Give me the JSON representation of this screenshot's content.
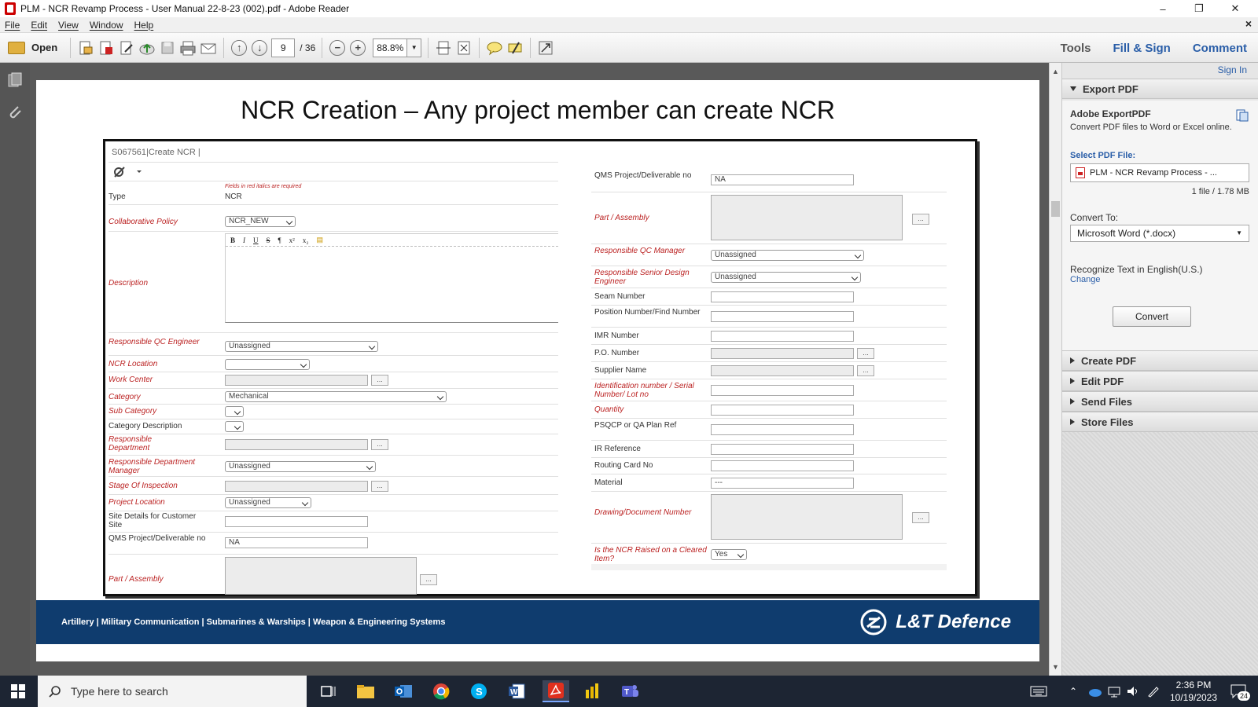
{
  "window": {
    "title": "PLM - NCR Revamp Process - User Manual 22-8-23 (002).pdf - Adobe Reader",
    "minimize": "–",
    "maximize": "❐",
    "close": "✕"
  },
  "menu": {
    "items": [
      "File",
      "Edit",
      "View",
      "Window",
      "Help"
    ],
    "close": "×"
  },
  "toolbar": {
    "open_label": "Open",
    "page_current": "9",
    "page_total": "/ 36",
    "zoom": "88.8%",
    "tools_label": "Tools",
    "fill_sign_label": "Fill & Sign",
    "comment_label": "Comment"
  },
  "slide": {
    "title": "NCR Creation – Any project member can create NCR",
    "footer_text": "Artillery | Military Communication | Submarines & Warships | Weapon & Engineering Systems",
    "logo_text": "L&T Defence"
  },
  "form": {
    "header": "S067561|Create NCR |",
    "required_note": "Fields in red italics are required",
    "left": {
      "type_label": "Type",
      "type_value": "NCR",
      "collab_label": "Collaborative Policy",
      "collab_value": "NCR_NEW",
      "description_label": "Description",
      "rte_buttons": [
        "B",
        "I",
        "U",
        "S",
        "¶",
        "x²",
        "x₂",
        "▤"
      ],
      "resp_qc_eng_label": "Responsible QC Engineer",
      "resp_qc_eng_value": "Unassigned",
      "ncr_location_label": "NCR Location",
      "work_center_label": "Work Center",
      "category_label": "Category",
      "category_value": "Mechanical",
      "sub_category_label": "Sub Category",
      "category_desc_label": "Category Description",
      "resp_dept_label": "Responsible Department",
      "resp_dept_mgr_label": "Responsible Department Manager",
      "resp_dept_mgr_value": "Unassigned",
      "stage_label": "Stage Of Inspection",
      "project_location_label": "Project Location",
      "project_location_value": "Unassigned",
      "site_details_label": "Site Details for Customer Site",
      "qms_label": "QMS Project/Deliverable no",
      "qms_value": "NA",
      "part_label": "Part / Assembly",
      "ellipsis": "..."
    },
    "right": {
      "qms_label": "QMS Project/Deliverable no",
      "qms_value": "NA",
      "part_label": "Part / Assembly",
      "resp_qc_mgr_label": "Responsible QC Manager",
      "resp_qc_mgr_value": "Unassigned",
      "resp_sde_label": "Responsible Senior Design Engineer",
      "resp_sde_value": "Unassigned",
      "seam_label": "Seam Number",
      "position_label": "Position Number/Find Number",
      "imr_label": "IMR Number",
      "po_label": "P.O. Number",
      "supplier_label": "Supplier Name",
      "ident_label": "Identification number / Serial Number/ Lot no",
      "quantity_label": "Quantity",
      "psqcp_label": "PSQCP or QA Plan Ref",
      "ir_label": "IR Reference",
      "routing_label": "Routing Card No",
      "material_label": "Material",
      "material_value": "---",
      "drawing_label": "Drawing/Document Number",
      "cleared_label": "Is the NCR Raised on a Cleared Item?",
      "cleared_value": "Yes",
      "ellipsis": "..."
    }
  },
  "right_panel": {
    "sign_in": "Sign In",
    "export_pdf": "Export PDF",
    "adobe_export": "Adobe ExportPDF",
    "export_desc": "Convert PDF files to Word or Excel online.",
    "select_file_label": "Select PDF File:",
    "selected_file": "PLM - NCR Revamp Process - ...",
    "file_info": "1 file / 1.78 MB",
    "convert_to_label": "Convert To:",
    "convert_to_value": "Microsoft Word (*.docx)",
    "recognize_text": "Recognize Text in English(U.S.)",
    "change_link": "Change",
    "convert_button": "Convert",
    "sections": [
      "Create PDF",
      "Edit PDF",
      "Send Files",
      "Store Files"
    ]
  },
  "taskbar": {
    "search_placeholder": "Type here to search",
    "time": "2:36 PM",
    "date": "10/19/2023",
    "notification_count": "24"
  },
  "colors": {
    "footer_blue": "#0f3c6e",
    "required_red": "#b22222",
    "link_blue": "#2a5ea8",
    "taskbar": "#1d2533"
  }
}
